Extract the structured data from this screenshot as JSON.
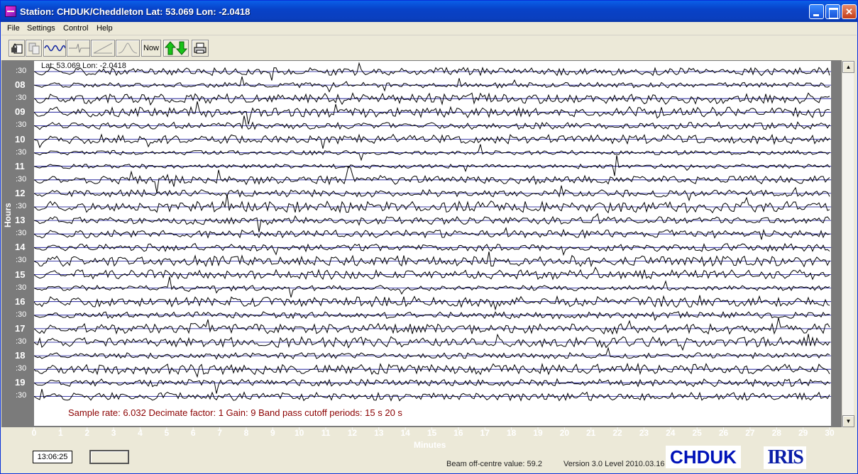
{
  "window": {
    "title": "Station: CHDUK/Cheddleton Lat: 53.069 Lon: -2.0418",
    "minimize_icon": "minimize-icon",
    "maximize_icon": "maximize-icon",
    "close_label": "✕"
  },
  "menu": {
    "items": [
      "File",
      "Settings",
      "Control",
      "Help"
    ]
  },
  "toolbar": {
    "tools": [
      {
        "name": "open-file-icon"
      },
      {
        "name": "copy-icon"
      },
      {
        "name": "waveform-icon"
      },
      {
        "name": "filter-spike-icon"
      },
      {
        "name": "ramp-icon"
      },
      {
        "name": "bandpass-icon"
      },
      {
        "name": "now-button",
        "label": "Now"
      },
      {
        "name": "up-down-arrows-icon"
      },
      {
        "name": "print-icon"
      }
    ]
  },
  "plot": {
    "coordinate_readout": "Lat: 53.069 Lon: -2.0418",
    "y_axis_label": "Hours",
    "x_axis_label": "Minutes",
    "hour_labels": [
      {
        "text": ":30",
        "major": false
      },
      {
        "text": "08",
        "major": true
      },
      {
        "text": ":30",
        "major": false
      },
      {
        "text": "09",
        "major": true
      },
      {
        "text": ":30",
        "major": false
      },
      {
        "text": "10",
        "major": true
      },
      {
        "text": ":30",
        "major": false
      },
      {
        "text": "11",
        "major": true
      },
      {
        "text": ":30",
        "major": false
      },
      {
        "text": "12",
        "major": true
      },
      {
        "text": ":30",
        "major": false
      },
      {
        "text": "13",
        "major": true
      },
      {
        "text": ":30",
        "major": false
      },
      {
        "text": "14",
        "major": true
      },
      {
        "text": ":30",
        "major": false
      },
      {
        "text": "15",
        "major": true
      },
      {
        "text": ":30",
        "major": false
      },
      {
        "text": "16",
        "major": true
      },
      {
        "text": ":30",
        "major": false
      },
      {
        "text": "17",
        "major": true
      },
      {
        "text": ":30",
        "major": false
      },
      {
        "text": "18",
        "major": true
      },
      {
        "text": ":30",
        "major": false
      },
      {
        "text": "19",
        "major": true
      },
      {
        "text": ":30",
        "major": false
      }
    ],
    "minute_ticks": [
      "0",
      "1",
      "2",
      "3",
      "4",
      "5",
      "6",
      "7",
      "8",
      "9",
      "10",
      "11",
      "12",
      "13",
      "14",
      "15",
      "16",
      "17",
      "18",
      "19",
      "20",
      "21",
      "22",
      "23",
      "24",
      "25",
      "26",
      "27",
      "28",
      "29",
      "30"
    ],
    "info_line": "Sample rate: 6.032  Decimate factor: 1  Gain: 9  Band pass cutoff periods: 15 s 20 s",
    "trace_color": "#000000",
    "baseline_color": "#00008b",
    "info_color": "#8b0000"
  },
  "status": {
    "time": "13:06:25",
    "beam_text": "Beam off-centre value: 59.2",
    "version_text": "Version 3.0 Level 2010.03.16",
    "station_logo": "CHDUK",
    "iris_logo": "IRIS"
  }
}
